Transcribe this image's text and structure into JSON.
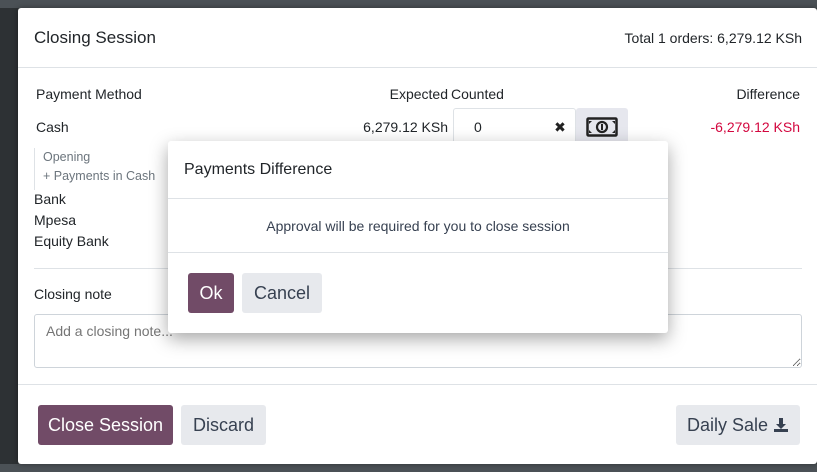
{
  "modal": {
    "title": "Closing Session",
    "total_orders": "Total 1 orders: 6,279.12 KSh"
  },
  "table": {
    "headers": {
      "method": "Payment Method",
      "expected": "Expected",
      "counted": "Counted",
      "difference": "Difference"
    },
    "cash": {
      "label": "Cash",
      "expected": "6,279.12 KSh",
      "counted": "0",
      "difference": "-6,279.12 KSh",
      "details": [
        "Opening",
        "+ Payments in Cash"
      ]
    },
    "other_methods": [
      "Bank",
      "Mpesa",
      "Equity Bank"
    ]
  },
  "closing_note": {
    "label": "Closing note",
    "placeholder": "Add a closing note..."
  },
  "footer": {
    "close_session": "Close Session",
    "discard": "Discard",
    "daily_sale": "Daily Sale"
  },
  "dialog": {
    "title": "Payments Difference",
    "message": "Approval will be required for you to close session",
    "ok": "Ok",
    "cancel": "Cancel"
  },
  "colors": {
    "primary": "#714b67",
    "negative": "#d3073f"
  }
}
